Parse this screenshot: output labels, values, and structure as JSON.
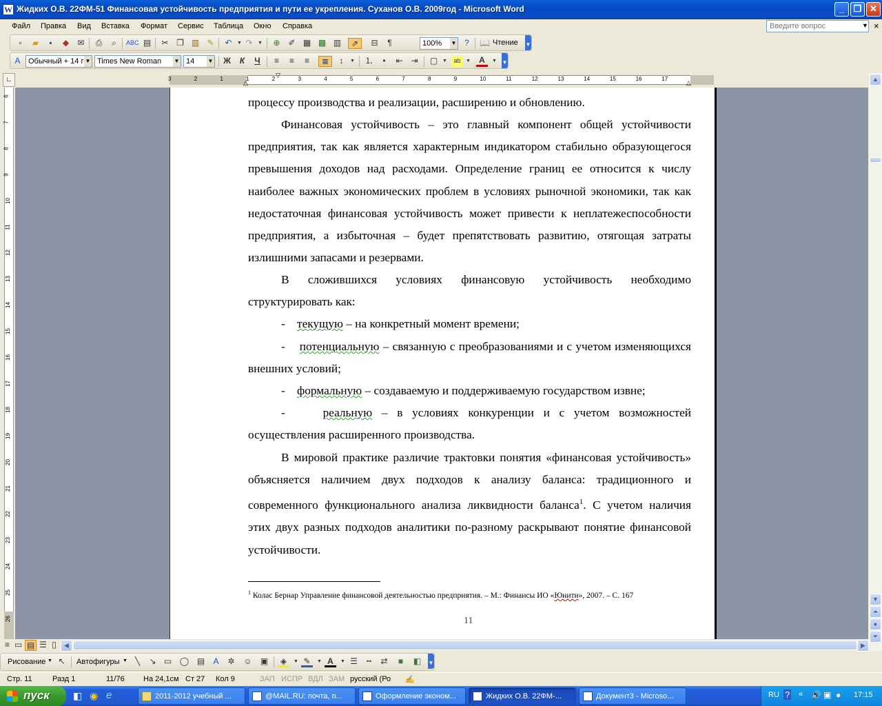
{
  "window": {
    "title": "Жидких О.В. 22ФМ-51 Финансовая устойчивость предприятия и пути ее укрепления. Суханов О.В. 2009год - Microsoft Word",
    "minimize": "_",
    "maximize": "❐",
    "close": "✕"
  },
  "menu": {
    "items": [
      "Файл",
      "Правка",
      "Вид",
      "Вставка",
      "Формат",
      "Сервис",
      "Таблица",
      "Окно",
      "Справка"
    ],
    "ask_placeholder": "Введите вопрос"
  },
  "toolbar": {
    "zoom": "100%",
    "reading_label": "Чтение"
  },
  "format_toolbar": {
    "style": "Обычный + 14 г",
    "font": "Times New Roman",
    "size": "14",
    "bold": "Ж",
    "italic": "К",
    "underline": "Ч"
  },
  "ruler": {
    "h_labels": [
      "3",
      "2",
      "1",
      "1",
      "2",
      "3",
      "4",
      "5",
      "6",
      "7",
      "8",
      "9",
      "10",
      "11",
      "12",
      "13",
      "14",
      "15",
      "16",
      "17"
    ],
    "v_labels": [
      "6",
      "7",
      "8",
      "9",
      "10",
      "11",
      "12",
      "13",
      "14",
      "15",
      "16",
      "17",
      "18",
      "19",
      "20",
      "21",
      "22",
      "23",
      "24",
      "25",
      "26"
    ]
  },
  "document": {
    "paragraphs": [
      {
        "id": "p0",
        "text": "процессу производства и реализации, расширению и обновлению."
      },
      {
        "id": "p1",
        "text": "Финансовая устойчивость – это главный компонент общей устойчивости предприятия, так как является характерным индикатором стабильно образующегося превышения доходов над расходами. Определение границ ее относится к числу наиболее важных экономических проблем в условиях рыночной экономики, так как недостаточная финансовая устойчивость может привести к неплатежеспособности предприятия, а избыточная – будет препятствовать развитию, отягощая затраты излишними запасами и резервами."
      },
      {
        "id": "p2",
        "text": "В сложившихся условиях финансовую устойчивость необходимо структурировать как:"
      }
    ],
    "list": [
      {
        "dash": "-",
        "word": "текущую",
        "rest": " – на конкретный момент времени;"
      },
      {
        "dash": "-",
        "word": "потенциальную",
        "rest": " – связанную с преобразованиями и с учетом изменяющихся внешних условий;"
      },
      {
        "dash": "-",
        "word": "формальную",
        "rest": " – создаваемую и поддерживаемую государством извне;"
      },
      {
        "dash": "-",
        "word": "реальную",
        "rest": " – в условиях конкуренции и с учетом возможностей осуществления расширенного производства."
      }
    ],
    "last_para": {
      "text_a": "В мировой практике различие трактовки понятия «финансовая устойчивость» объясняется наличием двух подходов к анализу баланса: традиционного и современного функционального анализа ликвидности баланса",
      "sup": "1",
      "text_b": ". С учетом наличия этих двух разных подходов аналитики по-разному раскрывают понятие финансовой устойчивости."
    },
    "footnote": {
      "num": "1",
      "text_a": " Колас Бернар Управление финансовой деятельностью предприятия. – М.: Финансы ИО «",
      "word": "Юнити",
      "text_b": "», 2007. – С. 167"
    },
    "page_number": "11"
  },
  "drawing": {
    "draw_label": "Рисование",
    "autoshapes_label": "Автофигуры"
  },
  "status": {
    "page": "Стр. 11",
    "section": "Разд 1",
    "pages": "11/76",
    "at": "На 24,1см",
    "line": "Ст 27",
    "col": "Кол 9",
    "rec": "ЗАП",
    "trk": "ИСПР",
    "ext": "ВДЛ",
    "ovr": "ЗАМ",
    "lang": "русский (Ро"
  },
  "taskbar": {
    "start": "пуск",
    "tasks": [
      {
        "label": "2011-2012 учебный ...",
        "active": false
      },
      {
        "label": "@MAIL.RU: почта, п...",
        "active": false
      },
      {
        "label": "Оформление эконом...",
        "active": false
      },
      {
        "label": "Жидких О.В. 22ФМ-...",
        "active": true
      },
      {
        "label": "Документ3 - Microso...",
        "active": false
      }
    ],
    "lang": "RU",
    "time": "17:15"
  },
  "colors": {
    "titlebar": "#0548c0",
    "workspace": "#8c95a6",
    "taskbar": "#245edb",
    "start": "#39992c",
    "spell_underline": "#3b9a3b"
  }
}
